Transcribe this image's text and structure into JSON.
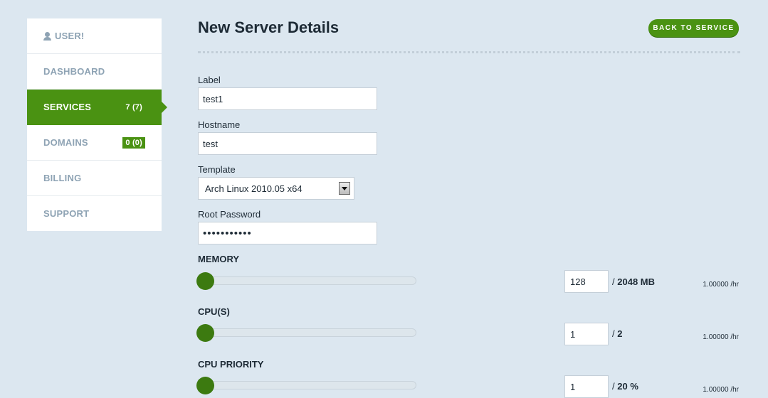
{
  "sidebar": {
    "items": [
      {
        "label": "USER!",
        "badge": ""
      },
      {
        "label": "DASHBOARD",
        "badge": ""
      },
      {
        "label": "SERVICES",
        "badge": "7 (7)"
      },
      {
        "label": "DOMAINS",
        "badge": "0 (0)"
      },
      {
        "label": "BILLING",
        "badge": ""
      },
      {
        "label": "SUPPORT",
        "badge": ""
      }
    ],
    "active_item": "SERVICES"
  },
  "header": {
    "title": "New Server Details",
    "back_button": "BACK TO SERVICE"
  },
  "form": {
    "label": {
      "label": "Label",
      "value": "test1"
    },
    "hostname": {
      "label": "Hostname",
      "value": "test"
    },
    "template": {
      "label": "Template",
      "value": "Arch Linux 2010.05 x64"
    },
    "password": {
      "label": "Root Password",
      "value": "•••••••••••"
    }
  },
  "resources": {
    "memory": {
      "title": "MEMORY",
      "value": "128",
      "max_prefix": "/",
      "max": "2048 MB",
      "rate": "1.00000 /hr",
      "level": 0
    },
    "cpus": {
      "title": "CPU(S)",
      "value": "1",
      "max_prefix": "/",
      "max": "2",
      "rate": "1.00000 /hr",
      "level": 0
    },
    "cpu_priority": {
      "title": "CPU PRIORITY",
      "value": "1",
      "max_prefix": "/",
      "max": "20 %",
      "rate": "1.00000 /hr",
      "level": 0
    }
  },
  "colors": {
    "accent": "#4a9212",
    "background": "#dce7f0"
  }
}
